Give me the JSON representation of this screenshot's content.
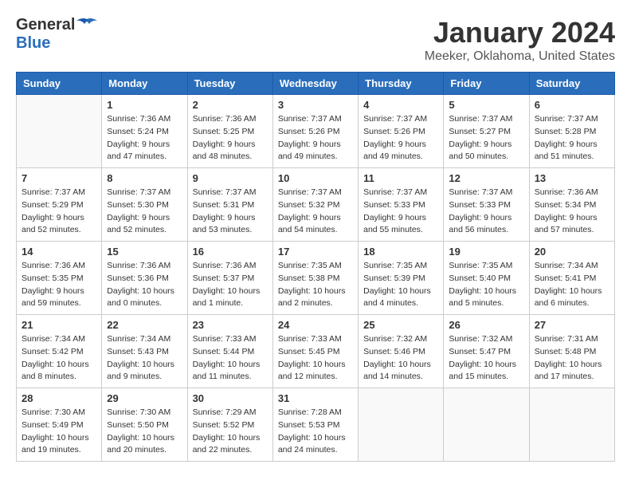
{
  "header": {
    "logo": {
      "line1": "General",
      "line2": "Blue"
    },
    "title": "January 2024",
    "subtitle": "Meeker, Oklahoma, United States"
  },
  "days_of_week": [
    "Sunday",
    "Monday",
    "Tuesday",
    "Wednesday",
    "Thursday",
    "Friday",
    "Saturday"
  ],
  "weeks": [
    [
      {
        "day": "",
        "info": ""
      },
      {
        "day": "1",
        "info": "Sunrise: 7:36 AM\nSunset: 5:24 PM\nDaylight: 9 hours\nand 47 minutes."
      },
      {
        "day": "2",
        "info": "Sunrise: 7:36 AM\nSunset: 5:25 PM\nDaylight: 9 hours\nand 48 minutes."
      },
      {
        "day": "3",
        "info": "Sunrise: 7:37 AM\nSunset: 5:26 PM\nDaylight: 9 hours\nand 49 minutes."
      },
      {
        "day": "4",
        "info": "Sunrise: 7:37 AM\nSunset: 5:26 PM\nDaylight: 9 hours\nand 49 minutes."
      },
      {
        "day": "5",
        "info": "Sunrise: 7:37 AM\nSunset: 5:27 PM\nDaylight: 9 hours\nand 50 minutes."
      },
      {
        "day": "6",
        "info": "Sunrise: 7:37 AM\nSunset: 5:28 PM\nDaylight: 9 hours\nand 51 minutes."
      }
    ],
    [
      {
        "day": "7",
        "info": "Sunrise: 7:37 AM\nSunset: 5:29 PM\nDaylight: 9 hours\nand 52 minutes."
      },
      {
        "day": "8",
        "info": "Sunrise: 7:37 AM\nSunset: 5:30 PM\nDaylight: 9 hours\nand 52 minutes."
      },
      {
        "day": "9",
        "info": "Sunrise: 7:37 AM\nSunset: 5:31 PM\nDaylight: 9 hours\nand 53 minutes."
      },
      {
        "day": "10",
        "info": "Sunrise: 7:37 AM\nSunset: 5:32 PM\nDaylight: 9 hours\nand 54 minutes."
      },
      {
        "day": "11",
        "info": "Sunrise: 7:37 AM\nSunset: 5:33 PM\nDaylight: 9 hours\nand 55 minutes."
      },
      {
        "day": "12",
        "info": "Sunrise: 7:37 AM\nSunset: 5:33 PM\nDaylight: 9 hours\nand 56 minutes."
      },
      {
        "day": "13",
        "info": "Sunrise: 7:36 AM\nSunset: 5:34 PM\nDaylight: 9 hours\nand 57 minutes."
      }
    ],
    [
      {
        "day": "14",
        "info": "Sunrise: 7:36 AM\nSunset: 5:35 PM\nDaylight: 9 hours\nand 59 minutes."
      },
      {
        "day": "15",
        "info": "Sunrise: 7:36 AM\nSunset: 5:36 PM\nDaylight: 10 hours\nand 0 minutes."
      },
      {
        "day": "16",
        "info": "Sunrise: 7:36 AM\nSunset: 5:37 PM\nDaylight: 10 hours\nand 1 minute."
      },
      {
        "day": "17",
        "info": "Sunrise: 7:35 AM\nSunset: 5:38 PM\nDaylight: 10 hours\nand 2 minutes."
      },
      {
        "day": "18",
        "info": "Sunrise: 7:35 AM\nSunset: 5:39 PM\nDaylight: 10 hours\nand 4 minutes."
      },
      {
        "day": "19",
        "info": "Sunrise: 7:35 AM\nSunset: 5:40 PM\nDaylight: 10 hours\nand 5 minutes."
      },
      {
        "day": "20",
        "info": "Sunrise: 7:34 AM\nSunset: 5:41 PM\nDaylight: 10 hours\nand 6 minutes."
      }
    ],
    [
      {
        "day": "21",
        "info": "Sunrise: 7:34 AM\nSunset: 5:42 PM\nDaylight: 10 hours\nand 8 minutes."
      },
      {
        "day": "22",
        "info": "Sunrise: 7:34 AM\nSunset: 5:43 PM\nDaylight: 10 hours\nand 9 minutes."
      },
      {
        "day": "23",
        "info": "Sunrise: 7:33 AM\nSunset: 5:44 PM\nDaylight: 10 hours\nand 11 minutes."
      },
      {
        "day": "24",
        "info": "Sunrise: 7:33 AM\nSunset: 5:45 PM\nDaylight: 10 hours\nand 12 minutes."
      },
      {
        "day": "25",
        "info": "Sunrise: 7:32 AM\nSunset: 5:46 PM\nDaylight: 10 hours\nand 14 minutes."
      },
      {
        "day": "26",
        "info": "Sunrise: 7:32 AM\nSunset: 5:47 PM\nDaylight: 10 hours\nand 15 minutes."
      },
      {
        "day": "27",
        "info": "Sunrise: 7:31 AM\nSunset: 5:48 PM\nDaylight: 10 hours\nand 17 minutes."
      }
    ],
    [
      {
        "day": "28",
        "info": "Sunrise: 7:30 AM\nSunset: 5:49 PM\nDaylight: 10 hours\nand 19 minutes."
      },
      {
        "day": "29",
        "info": "Sunrise: 7:30 AM\nSunset: 5:50 PM\nDaylight: 10 hours\nand 20 minutes."
      },
      {
        "day": "30",
        "info": "Sunrise: 7:29 AM\nSunset: 5:52 PM\nDaylight: 10 hours\nand 22 minutes."
      },
      {
        "day": "31",
        "info": "Sunrise: 7:28 AM\nSunset: 5:53 PM\nDaylight: 10 hours\nand 24 minutes."
      },
      {
        "day": "",
        "info": ""
      },
      {
        "day": "",
        "info": ""
      },
      {
        "day": "",
        "info": ""
      }
    ]
  ]
}
